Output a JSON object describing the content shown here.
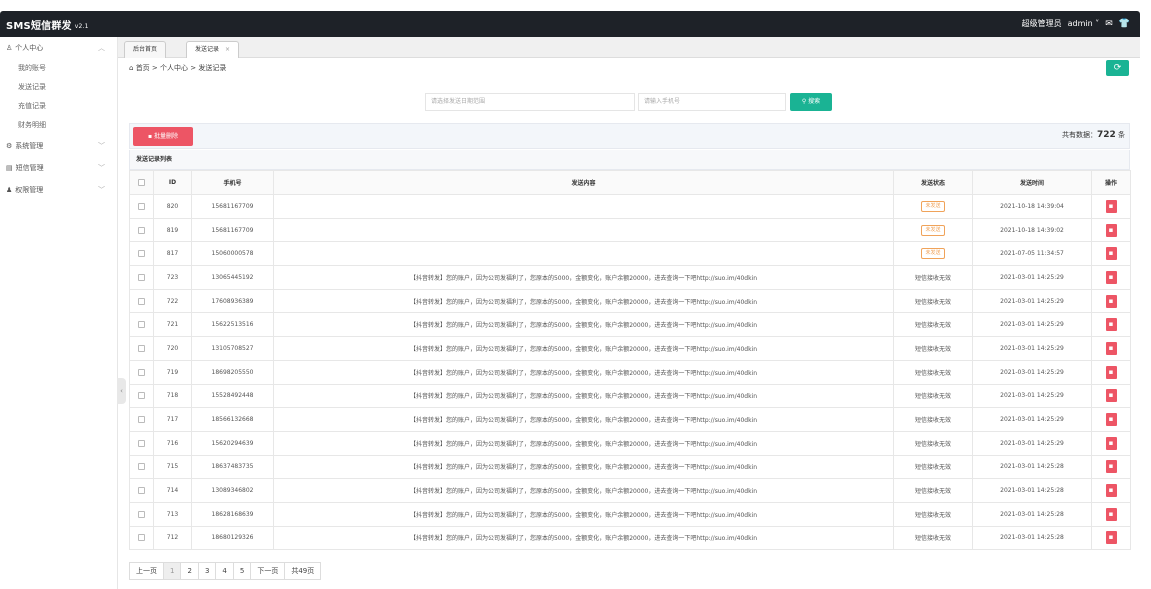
{
  "header": {
    "brand": "SMS短信群发",
    "version": "v2.1",
    "user_role": "超级管理员",
    "username": "admin"
  },
  "sidebar": {
    "groups": [
      {
        "label": "个人中心",
        "icon": "user-icon",
        "expanded": true,
        "items": [
          "我的账号",
          "发送记录",
          "充值记录",
          "财务明细"
        ]
      },
      {
        "label": "系统管理",
        "icon": "gear-icon",
        "expanded": false,
        "items": []
      },
      {
        "label": "短信管理",
        "icon": "message-icon",
        "expanded": false,
        "items": []
      },
      {
        "label": "权限管理",
        "icon": "users-icon",
        "expanded": false,
        "items": []
      }
    ]
  },
  "tabs": [
    {
      "label": "后台首页",
      "active": false
    },
    {
      "label": "发送记录",
      "active": true
    }
  ],
  "breadcrumb": [
    "首页",
    "个人中心",
    "发送记录"
  ],
  "search": {
    "date_placeholder": "请选择发送日期范围",
    "phone_placeholder": "请输入手机号",
    "button_label": "搜索"
  },
  "toolbar": {
    "batch_delete_label": "批量删除",
    "total_prefix": "共有数据：",
    "total_count": "722",
    "total_suffix": "条"
  },
  "list_title": "发送记录列表",
  "table": {
    "columns": [
      "ID",
      "手机号",
      "发送内容",
      "发送状态",
      "发送时间",
      "操作"
    ],
    "rows": [
      {
        "id": "820",
        "phone": "15681167709",
        "content": "",
        "status": "未发送",
        "status_type": "unsent",
        "time": "2021-10-18 14:39:04"
      },
      {
        "id": "819",
        "phone": "15681167709",
        "content": "",
        "status": "未发送",
        "status_type": "unsent",
        "time": "2021-10-18 14:39:02"
      },
      {
        "id": "817",
        "phone": "15060000578",
        "content": "",
        "status": "未发送",
        "status_type": "unsent",
        "time": "2021-07-05 11:34:57"
      },
      {
        "id": "723",
        "phone": "13065445192",
        "content": "【抖音转发】您的账户，因为公司发福利了，您原本的5000，金额变化，账户余额20000，进去查询一下吧http://suo.im/40dkin",
        "status": "短信接收无效",
        "status_type": "text",
        "time": "2021-03-01 14:25:29"
      },
      {
        "id": "722",
        "phone": "17608936389",
        "content": "【抖音转发】您的账户，因为公司发福利了，您原本的5000，金额变化，账户余额20000，进去查询一下吧http://suo.im/40dkin",
        "status": "短信接收无效",
        "status_type": "text",
        "time": "2021-03-01 14:25:29"
      },
      {
        "id": "721",
        "phone": "15622513516",
        "content": "【抖音转发】您的账户，因为公司发福利了，您原本的5000，金额变化，账户余额20000，进去查询一下吧http://suo.im/40dkin",
        "status": "短信接收无效",
        "status_type": "text",
        "time": "2021-03-01 14:25:29"
      },
      {
        "id": "720",
        "phone": "13105708527",
        "content": "【抖音转发】您的账户，因为公司发福利了，您原本的5000，金额变化，账户余额20000，进去查询一下吧http://suo.im/40dkin",
        "status": "短信接收无效",
        "status_type": "text",
        "time": "2021-03-01 14:25:29"
      },
      {
        "id": "719",
        "phone": "18698205550",
        "content": "【抖音转发】您的账户，因为公司发福利了，您原本的5000，金额变化，账户余额20000，进去查询一下吧http://suo.im/40dkin",
        "status": "短信接收无效",
        "status_type": "text",
        "time": "2021-03-01 14:25:29"
      },
      {
        "id": "718",
        "phone": "15528492448",
        "content": "【抖音转发】您的账户，因为公司发福利了，您原本的5000，金额变化，账户余额20000，进去查询一下吧http://suo.im/40dkin",
        "status": "短信接收无效",
        "status_type": "text",
        "time": "2021-03-01 14:25:29"
      },
      {
        "id": "717",
        "phone": "18566132668",
        "content": "【抖音转发】您的账户，因为公司发福利了，您原本的5000，金额变化，账户余额20000，进去查询一下吧http://suo.im/40dkin",
        "status": "短信接收无效",
        "status_type": "text",
        "time": "2021-03-01 14:25:29"
      },
      {
        "id": "716",
        "phone": "15620294639",
        "content": "【抖音转发】您的账户，因为公司发福利了，您原本的5000，金额变化，账户余额20000，进去查询一下吧http://suo.im/40dkin",
        "status": "短信接收无效",
        "status_type": "text",
        "time": "2021-03-01 14:25:29"
      },
      {
        "id": "715",
        "phone": "18637483735",
        "content": "【抖音转发】您的账户，因为公司发福利了，您原本的5000，金额变化，账户余额20000，进去查询一下吧http://suo.im/40dkin",
        "status": "短信接收无效",
        "status_type": "text",
        "time": "2021-03-01 14:25:28"
      },
      {
        "id": "714",
        "phone": "13089346802",
        "content": "【抖音转发】您的账户，因为公司发福利了，您原本的5000，金额变化，账户余额20000，进去查询一下吧http://suo.im/40dkin",
        "status": "短信接收无效",
        "status_type": "text",
        "time": "2021-03-01 14:25:28"
      },
      {
        "id": "713",
        "phone": "18628168639",
        "content": "【抖音转发】您的账户，因为公司发福利了，您原本的5000，金额变化，账户余额20000，进去查询一下吧http://suo.im/40dkin",
        "status": "短信接收无效",
        "status_type": "text",
        "time": "2021-03-01 14:25:28"
      },
      {
        "id": "712",
        "phone": "18680129326",
        "content": "【抖音转发】您的账户，因为公司发福利了，您原本的5000，金额变化，账户余额20000，进去查询一下吧http://suo.im/40dkin",
        "status": "短信接收无效",
        "status_type": "text",
        "time": "2021-03-01 14:25:28"
      }
    ]
  },
  "pagination": {
    "prev_label": "上一页",
    "pages": [
      "1",
      "2",
      "3",
      "4",
      "5"
    ],
    "current_page": "1",
    "next_label": "下一页",
    "total_pages_label": "共49页"
  },
  "colors": {
    "topbar": "#1e2228",
    "primary_green": "#1ab394",
    "danger_red": "#ed5565",
    "unsent_orange": "#f0a35a"
  }
}
